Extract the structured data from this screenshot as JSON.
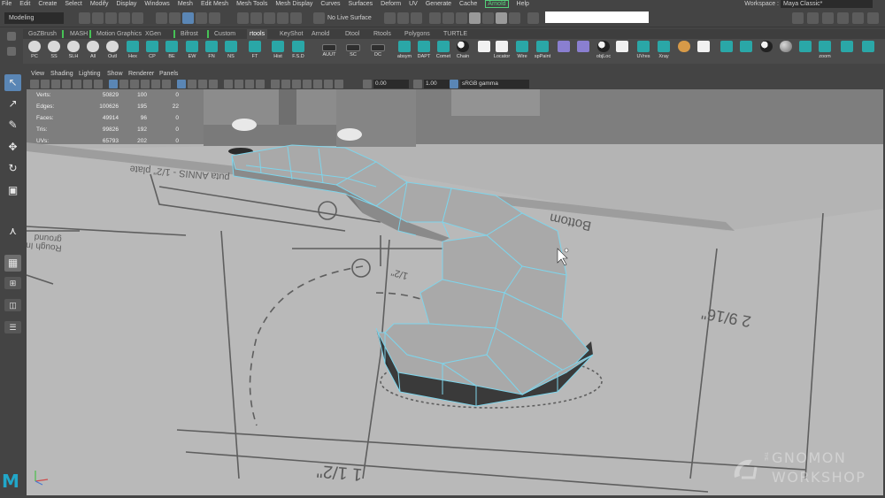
{
  "menubar": {
    "items": [
      "File",
      "Edit",
      "Create",
      "Select",
      "Modify",
      "Display",
      "Windows",
      "Mesh",
      "Edit Mesh",
      "Mesh Tools",
      "Mesh Display",
      "Curves",
      "Surfaces",
      "Deform",
      "UV",
      "Generate",
      "Cache",
      "Arnold",
      "Help"
    ],
    "workspace_label": "Workspace :",
    "workspace_value": "Maya Classic*"
  },
  "statusline": {
    "mode": "Modeling",
    "live_surface": "No Live Surface",
    "command_value": ""
  },
  "shelf": {
    "tabs": [
      "GoZBrush",
      "MASH",
      "Motion Graphics",
      "XGen",
      "Bifrost",
      "Custom",
      "rtools",
      "KeyShot",
      "Arnold",
      "Dtool",
      "Rtools",
      "Polygons",
      "TURTLE"
    ],
    "active_tab": "rtools",
    "buttons": [
      {
        "label": "PC",
        "icon": "eye-icon"
      },
      {
        "label": "SS",
        "icon": "eye-icon"
      },
      {
        "label": "SLH",
        "icon": "eye-icon"
      },
      {
        "label": "All",
        "icon": "eye-icon"
      },
      {
        "label": "Outl",
        "icon": "eye-icon"
      },
      {
        "label": "Hex",
        "icon": "teal-shelf-icon"
      },
      {
        "label": "CP",
        "icon": "teal-shelf-icon"
      },
      {
        "label": "BE",
        "icon": "teal-shelf-icon"
      },
      {
        "label": "EW",
        "icon": "teal-shelf-icon"
      },
      {
        "label": "FN",
        "icon": "teal-shelf-icon"
      },
      {
        "label": "NS",
        "icon": "teal-shelf-icon"
      },
      {
        "label": "FT",
        "icon": "teal-shelf-icon"
      },
      {
        "label": "Hist",
        "icon": "teal-shelf-icon"
      },
      {
        "label": "F.S.D",
        "icon": "teal-shelf-icon"
      },
      {
        "label": "AUUT",
        "icon": "square-button-icon"
      },
      {
        "label": "SC",
        "icon": "square-button-icon"
      },
      {
        "label": "DC",
        "icon": "square-button-icon"
      },
      {
        "label": "absym",
        "icon": "teal-shelf-icon"
      },
      {
        "label": "DAPT",
        "icon": "teal-shelf-icon"
      },
      {
        "label": "Comet",
        "icon": "teal-shelf-icon"
      },
      {
        "label": "Chain",
        "icon": "yin-yang-icon"
      },
      {
        "label": "",
        "icon": "white-square-icon"
      },
      {
        "label": "Locator",
        "icon": "locator-icon"
      },
      {
        "label": "Wire",
        "icon": "teal-shelf-icon"
      },
      {
        "label": "spPaint",
        "icon": "teal-shelf-icon"
      },
      {
        "label": "",
        "icon": "cube-outline-icon"
      },
      {
        "label": "",
        "icon": "bend-icon"
      },
      {
        "label": "objLoc",
        "icon": "yin-yang-icon"
      },
      {
        "label": "",
        "icon": "checker-icon"
      },
      {
        "label": "UVres",
        "icon": "teal-shelf-icon"
      },
      {
        "label": "Xray",
        "icon": "teal-shelf-icon"
      },
      {
        "label": "",
        "icon": "orange-k-icon"
      },
      {
        "label": "",
        "icon": "pipe-icon"
      },
      {
        "label": "",
        "icon": "teal-shelf-icon"
      },
      {
        "label": "",
        "icon": "teal-shelf-icon"
      },
      {
        "label": "",
        "icon": "yin-yang-icon"
      },
      {
        "label": "",
        "icon": "sphere-icon"
      },
      {
        "label": "",
        "icon": "teal-shelf-icon"
      },
      {
        "label": "zoom",
        "icon": "teal-shelf-icon"
      },
      {
        "label": "",
        "icon": "teal-shelf-icon"
      },
      {
        "label": "",
        "icon": "teal-shelf-icon"
      },
      {
        "label": "",
        "icon": "teal-shelf-icon"
      },
      {
        "label": "",
        "icon": "teal-shelf-icon"
      }
    ]
  },
  "panel": {
    "menu": [
      "View",
      "Shading",
      "Lighting",
      "Show",
      "Renderer",
      "Panels"
    ],
    "near_clip": "0.00",
    "far_clip": "1.00",
    "color_space": "sRGB gamma"
  },
  "hud": {
    "rows": [
      {
        "label": "Verts:",
        "total": "50829",
        "selected": "100",
        "extra": "0"
      },
      {
        "label": "Edges:",
        "total": "100626",
        "selected": "195",
        "extra": "22"
      },
      {
        "label": "Faces:",
        "total": "49914",
        "selected": "96",
        "extra": "0"
      },
      {
        "label": "Tris:",
        "total": "99826",
        "selected": "192",
        "extra": "0"
      },
      {
        "label": "UVs:",
        "total": "65793",
        "selected": "202",
        "extra": "0"
      }
    ]
  },
  "blueprint_text": {
    "bottom": "Bottom",
    "dim_right": "2 9/16\"",
    "dim_bottom": "1 1/2\"",
    "dim_center": "1/2\"",
    "plate": "puta ANNIS - 1/2\" plate",
    "rough": "Rough In",
    "ground": "ground"
  },
  "watermark": {
    "the": "THE",
    "line1": "GNOMON",
    "line2": "WORKSHOP"
  },
  "colors": {
    "wireframe": "#7fd4ea",
    "accent": "#5a86b5",
    "viewport_bg": "#7d7d7d"
  }
}
